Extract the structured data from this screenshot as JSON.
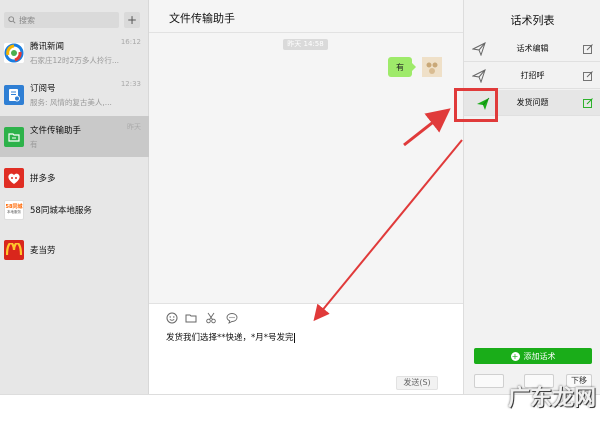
{
  "sidebar": {
    "search_placeholder": "搜索",
    "add_label": "+",
    "chats": [
      {
        "name": "腾讯新闻",
        "preview": "石家庄12时2万多人拎行...",
        "time": "16:12",
        "icon": "tencent-news-icon"
      },
      {
        "name": "订阅号",
        "preview": "服务: 风情的复古美人,...",
        "time": "12:33",
        "icon": "subscription-icon"
      },
      {
        "name": "文件传输助手",
        "preview": "有",
        "time": "昨天",
        "icon": "file-transfer-icon"
      },
      {
        "name": "拼多多",
        "preview": "",
        "time": "",
        "icon": "pinduoduo-icon"
      },
      {
        "name": "58同城本地服务",
        "preview": "",
        "time": "",
        "icon": "58-tongcheng-icon"
      },
      {
        "name": "麦当劳",
        "preview": "",
        "time": "",
        "icon": "mcdonalds-icon"
      }
    ],
    "logo_58_text": "58同城",
    "logo_58_sub": "本地服务"
  },
  "chat": {
    "title": "文件传输助手",
    "time_separator": "昨天 14:58",
    "message": "有",
    "draft": "发货我们选择**快递，*月*号发完",
    "send_label": "发送(S)"
  },
  "scripts": {
    "title": "话术列表",
    "items": [
      {
        "label": "话术编辑",
        "active": false
      },
      {
        "label": "打招呼",
        "active": false
      },
      {
        "label": "发货问题",
        "active": true
      }
    ],
    "add_label": "添加话术",
    "down_label": "下移"
  },
  "colors": {
    "accent_green": "#1aad19",
    "bubble_green": "#9eea6a",
    "annotation_red": "#e03a3a"
  },
  "watermark": "广东龙网"
}
